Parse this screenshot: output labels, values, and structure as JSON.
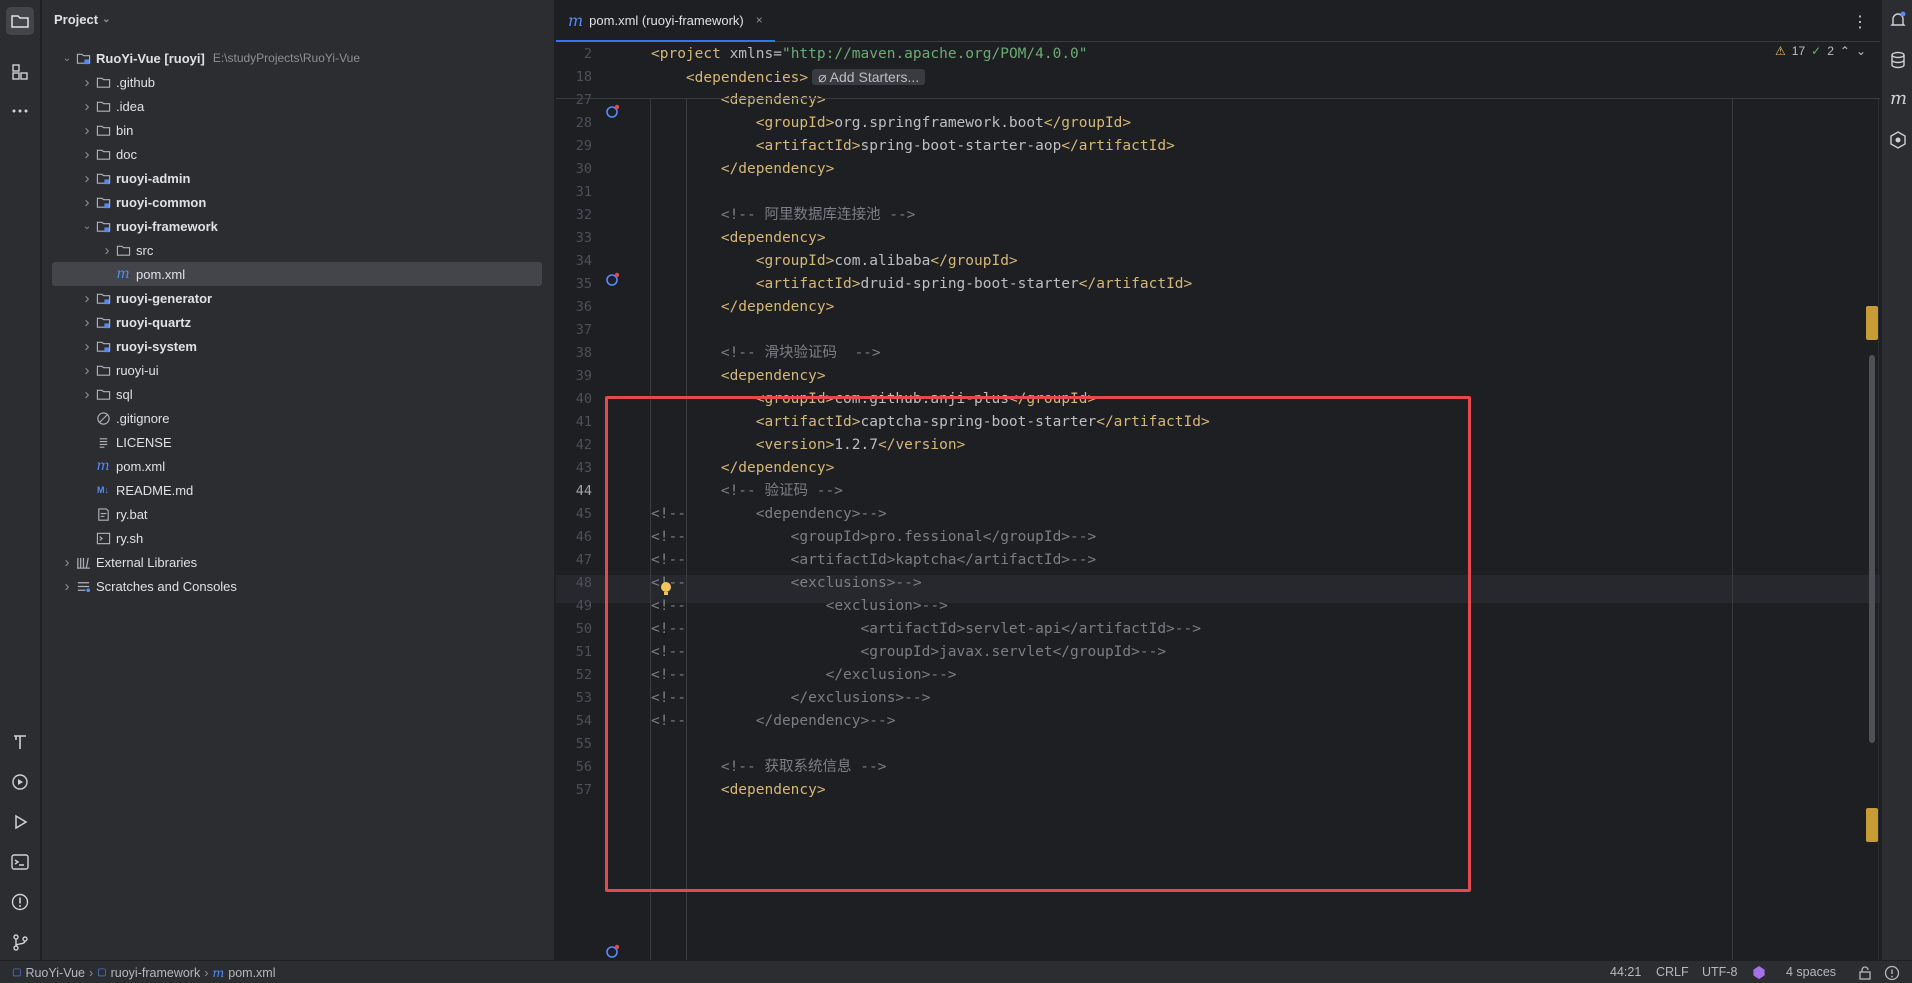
{
  "project_panel": {
    "title": "Project",
    "tree": [
      {
        "label": "RuoYi-Vue [ruoyi]",
        "path": "E:\\studyProjects\\RuoYi-Vue",
        "icon": "module-icon",
        "chev": "v"
      },
      {
        "label": ".github",
        "icon": "folder-icon",
        "chev": ">"
      },
      {
        "label": ".idea",
        "icon": "folder-icon",
        "chev": ">"
      },
      {
        "label": "bin",
        "icon": "folder-icon",
        "chev": ">"
      },
      {
        "label": "doc",
        "icon": "folder-icon",
        "chev": ">"
      },
      {
        "label": "ruoyi-admin",
        "icon": "module-icon",
        "chev": ">"
      },
      {
        "label": "ruoyi-common",
        "icon": "module-icon",
        "chev": ">"
      },
      {
        "label": "ruoyi-framework",
        "icon": "module-icon",
        "chev": "v"
      },
      {
        "label": "src",
        "icon": "folder-icon",
        "chev": ">"
      },
      {
        "label": "pom.xml",
        "icon": "maven-icon",
        "chev": ""
      },
      {
        "label": "ruoyi-generator",
        "icon": "module-icon",
        "chev": ">"
      },
      {
        "label": "ruoyi-quartz",
        "icon": "module-icon",
        "chev": ">"
      },
      {
        "label": "ruoyi-system",
        "icon": "module-icon",
        "chev": ">"
      },
      {
        "label": "ruoyi-ui",
        "icon": "folder-icon",
        "chev": ">"
      },
      {
        "label": "sql",
        "icon": "folder-icon",
        "chev": ">"
      },
      {
        "label": ".gitignore",
        "icon": "ignore-icon",
        "chev": ""
      },
      {
        "label": "LICENSE",
        "icon": "text-file-icon",
        "chev": ""
      },
      {
        "label": "pom.xml",
        "icon": "maven-icon",
        "chev": ""
      },
      {
        "label": "README.md",
        "icon": "markdown-icon",
        "chev": ""
      },
      {
        "label": "ry.bat",
        "icon": "script-icon",
        "chev": ""
      },
      {
        "label": "ry.sh",
        "icon": "shell-icon",
        "chev": ""
      },
      {
        "label": "External Libraries",
        "icon": "library-icon",
        "chev": ">"
      },
      {
        "label": "Scratches and Consoles",
        "icon": "scratch-icon",
        "chev": ">"
      }
    ]
  },
  "editor": {
    "tab_label": "pom.xml (ruoyi-framework)",
    "tab_close": "×",
    "menu_glyph": "⋮",
    "problems": {
      "warnings": "17",
      "ok": "2"
    },
    "add_starters": "Add Starters...",
    "current_line": "44",
    "lines": [
      {
        "n": "2",
        "parts": [
          [
            "tg",
            "<project "
          ],
          [
            "at",
            "xmlns"
          ],
          [
            "tx",
            "="
          ],
          [
            "st",
            "\"http://maven.apache.org/POM/4.0.0\""
          ]
        ]
      },
      {
        "n": "18",
        "parts": [
          [
            "tg",
            "    <dependencies>"
          ]
        ]
      },
      {
        "n": "27",
        "parts": [
          [
            "tg",
            "        <dependency>"
          ]
        ]
      },
      {
        "n": "28",
        "parts": [
          [
            "tg",
            "            <groupId>"
          ],
          [
            "tx",
            "org.springframework.boot"
          ],
          [
            "tg",
            "</groupId>"
          ]
        ]
      },
      {
        "n": "29",
        "parts": [
          [
            "tg",
            "            <artifactId>"
          ],
          [
            "tx",
            "spring-boot-starter-aop"
          ],
          [
            "tg",
            "</artifactId>"
          ]
        ]
      },
      {
        "n": "30",
        "parts": [
          [
            "tg",
            "        </dependency>"
          ]
        ]
      },
      {
        "n": "31",
        "parts": []
      },
      {
        "n": "32",
        "parts": [
          [
            "cm",
            "        <!-- 阿里数据库连接池 -->"
          ]
        ]
      },
      {
        "n": "33",
        "parts": [
          [
            "tg",
            "        <dependency>"
          ]
        ]
      },
      {
        "n": "34",
        "parts": [
          [
            "tg",
            "            <groupId>"
          ],
          [
            "tx",
            "com.alibaba"
          ],
          [
            "tg",
            "</groupId>"
          ]
        ]
      },
      {
        "n": "35",
        "parts": [
          [
            "tg",
            "            <artifactId>"
          ],
          [
            "tx",
            "druid-spring-boot-starter"
          ],
          [
            "tg",
            "</artifactId>"
          ]
        ]
      },
      {
        "n": "36",
        "parts": [
          [
            "tg",
            "        </dependency>"
          ]
        ]
      },
      {
        "n": "37",
        "parts": []
      },
      {
        "n": "38",
        "parts": [
          [
            "cm",
            "        <!-- 滑块验证码  -->"
          ]
        ]
      },
      {
        "n": "39",
        "parts": [
          [
            "tg",
            "        <dependency>"
          ]
        ]
      },
      {
        "n": "40",
        "parts": [
          [
            "tg",
            "            <groupId>"
          ],
          [
            "tx",
            "com.github.anji-plus"
          ],
          [
            "tg",
            "</groupId>"
          ]
        ]
      },
      {
        "n": "41",
        "parts": [
          [
            "tg",
            "            <artifactId>"
          ],
          [
            "tx",
            "captcha-spring-boot-starter"
          ],
          [
            "tg",
            "</artifactId>"
          ]
        ]
      },
      {
        "n": "42",
        "parts": [
          [
            "tg",
            "            <version>"
          ],
          [
            "tx",
            "1.2.7"
          ],
          [
            "tg",
            "</version>"
          ]
        ]
      },
      {
        "n": "43",
        "parts": [
          [
            "tg",
            "        </dependency>"
          ]
        ]
      },
      {
        "n": "44",
        "parts": [
          [
            "cm",
            "        <!-- 验证码 -->"
          ]
        ]
      },
      {
        "n": "45",
        "parts": [
          [
            "cm",
            "<!--        <dependency>-->"
          ]
        ]
      },
      {
        "n": "46",
        "parts": [
          [
            "cm",
            "<!--            <groupId>pro.fessional</groupId>-->"
          ]
        ]
      },
      {
        "n": "47",
        "parts": [
          [
            "cm",
            "<!--            <artifactId>kaptcha</artifactId>-->"
          ]
        ]
      },
      {
        "n": "48",
        "parts": [
          [
            "cm",
            "<!--            <exclusions>-->"
          ]
        ]
      },
      {
        "n": "49",
        "parts": [
          [
            "cm",
            "<!--                <exclusion>-->"
          ]
        ]
      },
      {
        "n": "50",
        "parts": [
          [
            "cm",
            "<!--                    <artifactId>servlet-api</artifactId>-->"
          ]
        ]
      },
      {
        "n": "51",
        "parts": [
          [
            "cm",
            "<!--                    <groupId>javax.servlet</groupId>-->"
          ]
        ]
      },
      {
        "n": "52",
        "parts": [
          [
            "cm",
            "<!--                </exclusion>-->"
          ]
        ]
      },
      {
        "n": "53",
        "parts": [
          [
            "cm",
            "<!--            </exclusions>-->"
          ]
        ]
      },
      {
        "n": "54",
        "parts": [
          [
            "cm",
            "<!--        </dependency>-->"
          ]
        ]
      },
      {
        "n": "55",
        "parts": []
      },
      {
        "n": "56",
        "parts": [
          [
            "cm",
            "        <!-- 获取系统信息 -->"
          ]
        ]
      },
      {
        "n": "57",
        "parts": [
          [
            "tg",
            "        <dependency>"
          ]
        ]
      }
    ]
  },
  "status_bar": {
    "breadcrumbs": [
      "RuoYi-Vue",
      "ruoyi-framework",
      "pom.xml"
    ],
    "position": "44:21",
    "line_sep": "CRLF",
    "encoding": "UTF-8",
    "indent": "4 spaces"
  },
  "colors": {
    "accent": "#3574f0",
    "highlight_box": "#e5484d",
    "tag": "#d5b778",
    "comment": "#7a7e85",
    "string": "#6aab73"
  }
}
